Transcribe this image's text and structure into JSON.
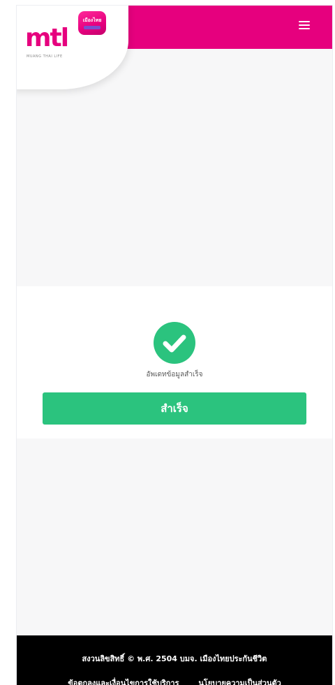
{
  "header": {
    "logo_text": "mtl",
    "logo_badge_text": "เมืองไทย",
    "logo_subtitle": "MUANG THAI LIFE",
    "brand_color": "#e6007e",
    "menu_icon": "hamburger-menu-icon"
  },
  "result": {
    "icon": "check-circle-icon",
    "message": "อัพเดทข้อมูลสำเร็จ",
    "button_label": "สำเร็จ",
    "success_color": "#2bc37e"
  },
  "footer": {
    "copyright": "สงวนลิขสิทธิ์ © พ.ศ. 2504 บมจ. เมืองไทยประกันชีวิต",
    "links": [
      "ข้อตกลงและเงื่อนไขการใช้บริการ",
      "นโยบายความเป็นส่วนตัว"
    ]
  }
}
